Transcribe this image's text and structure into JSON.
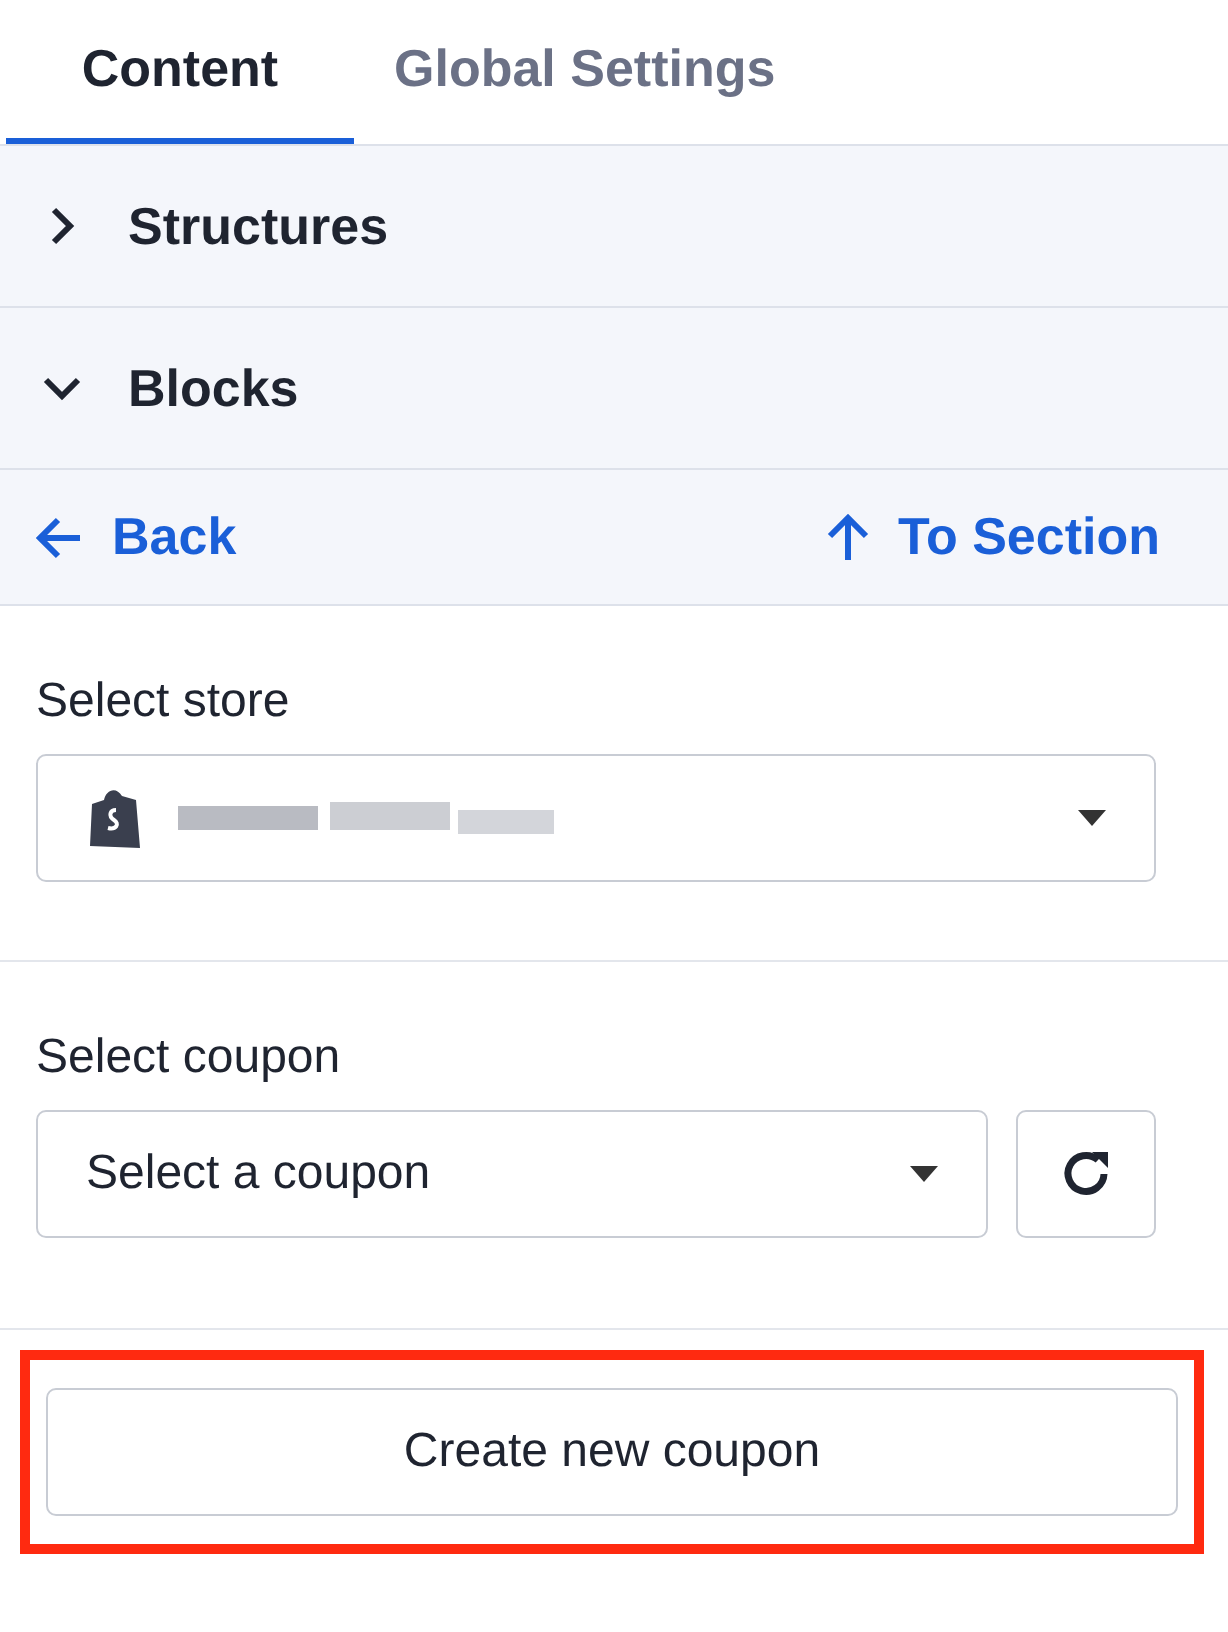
{
  "tabs": [
    {
      "label": "Content",
      "selected": true
    },
    {
      "label": "Global Settings",
      "selected": false
    }
  ],
  "sections": [
    {
      "label": "Structures",
      "expanded": false
    },
    {
      "label": "Blocks",
      "expanded": true
    }
  ],
  "nav": {
    "back": "Back",
    "to_section": "To Section"
  },
  "store_field": {
    "label": "Select store",
    "value_redacted": true
  },
  "coupon_field": {
    "label": "Select coupon",
    "placeholder": "Select a coupon"
  },
  "create_button": {
    "label": "Create new coupon",
    "highlighted": true
  }
}
